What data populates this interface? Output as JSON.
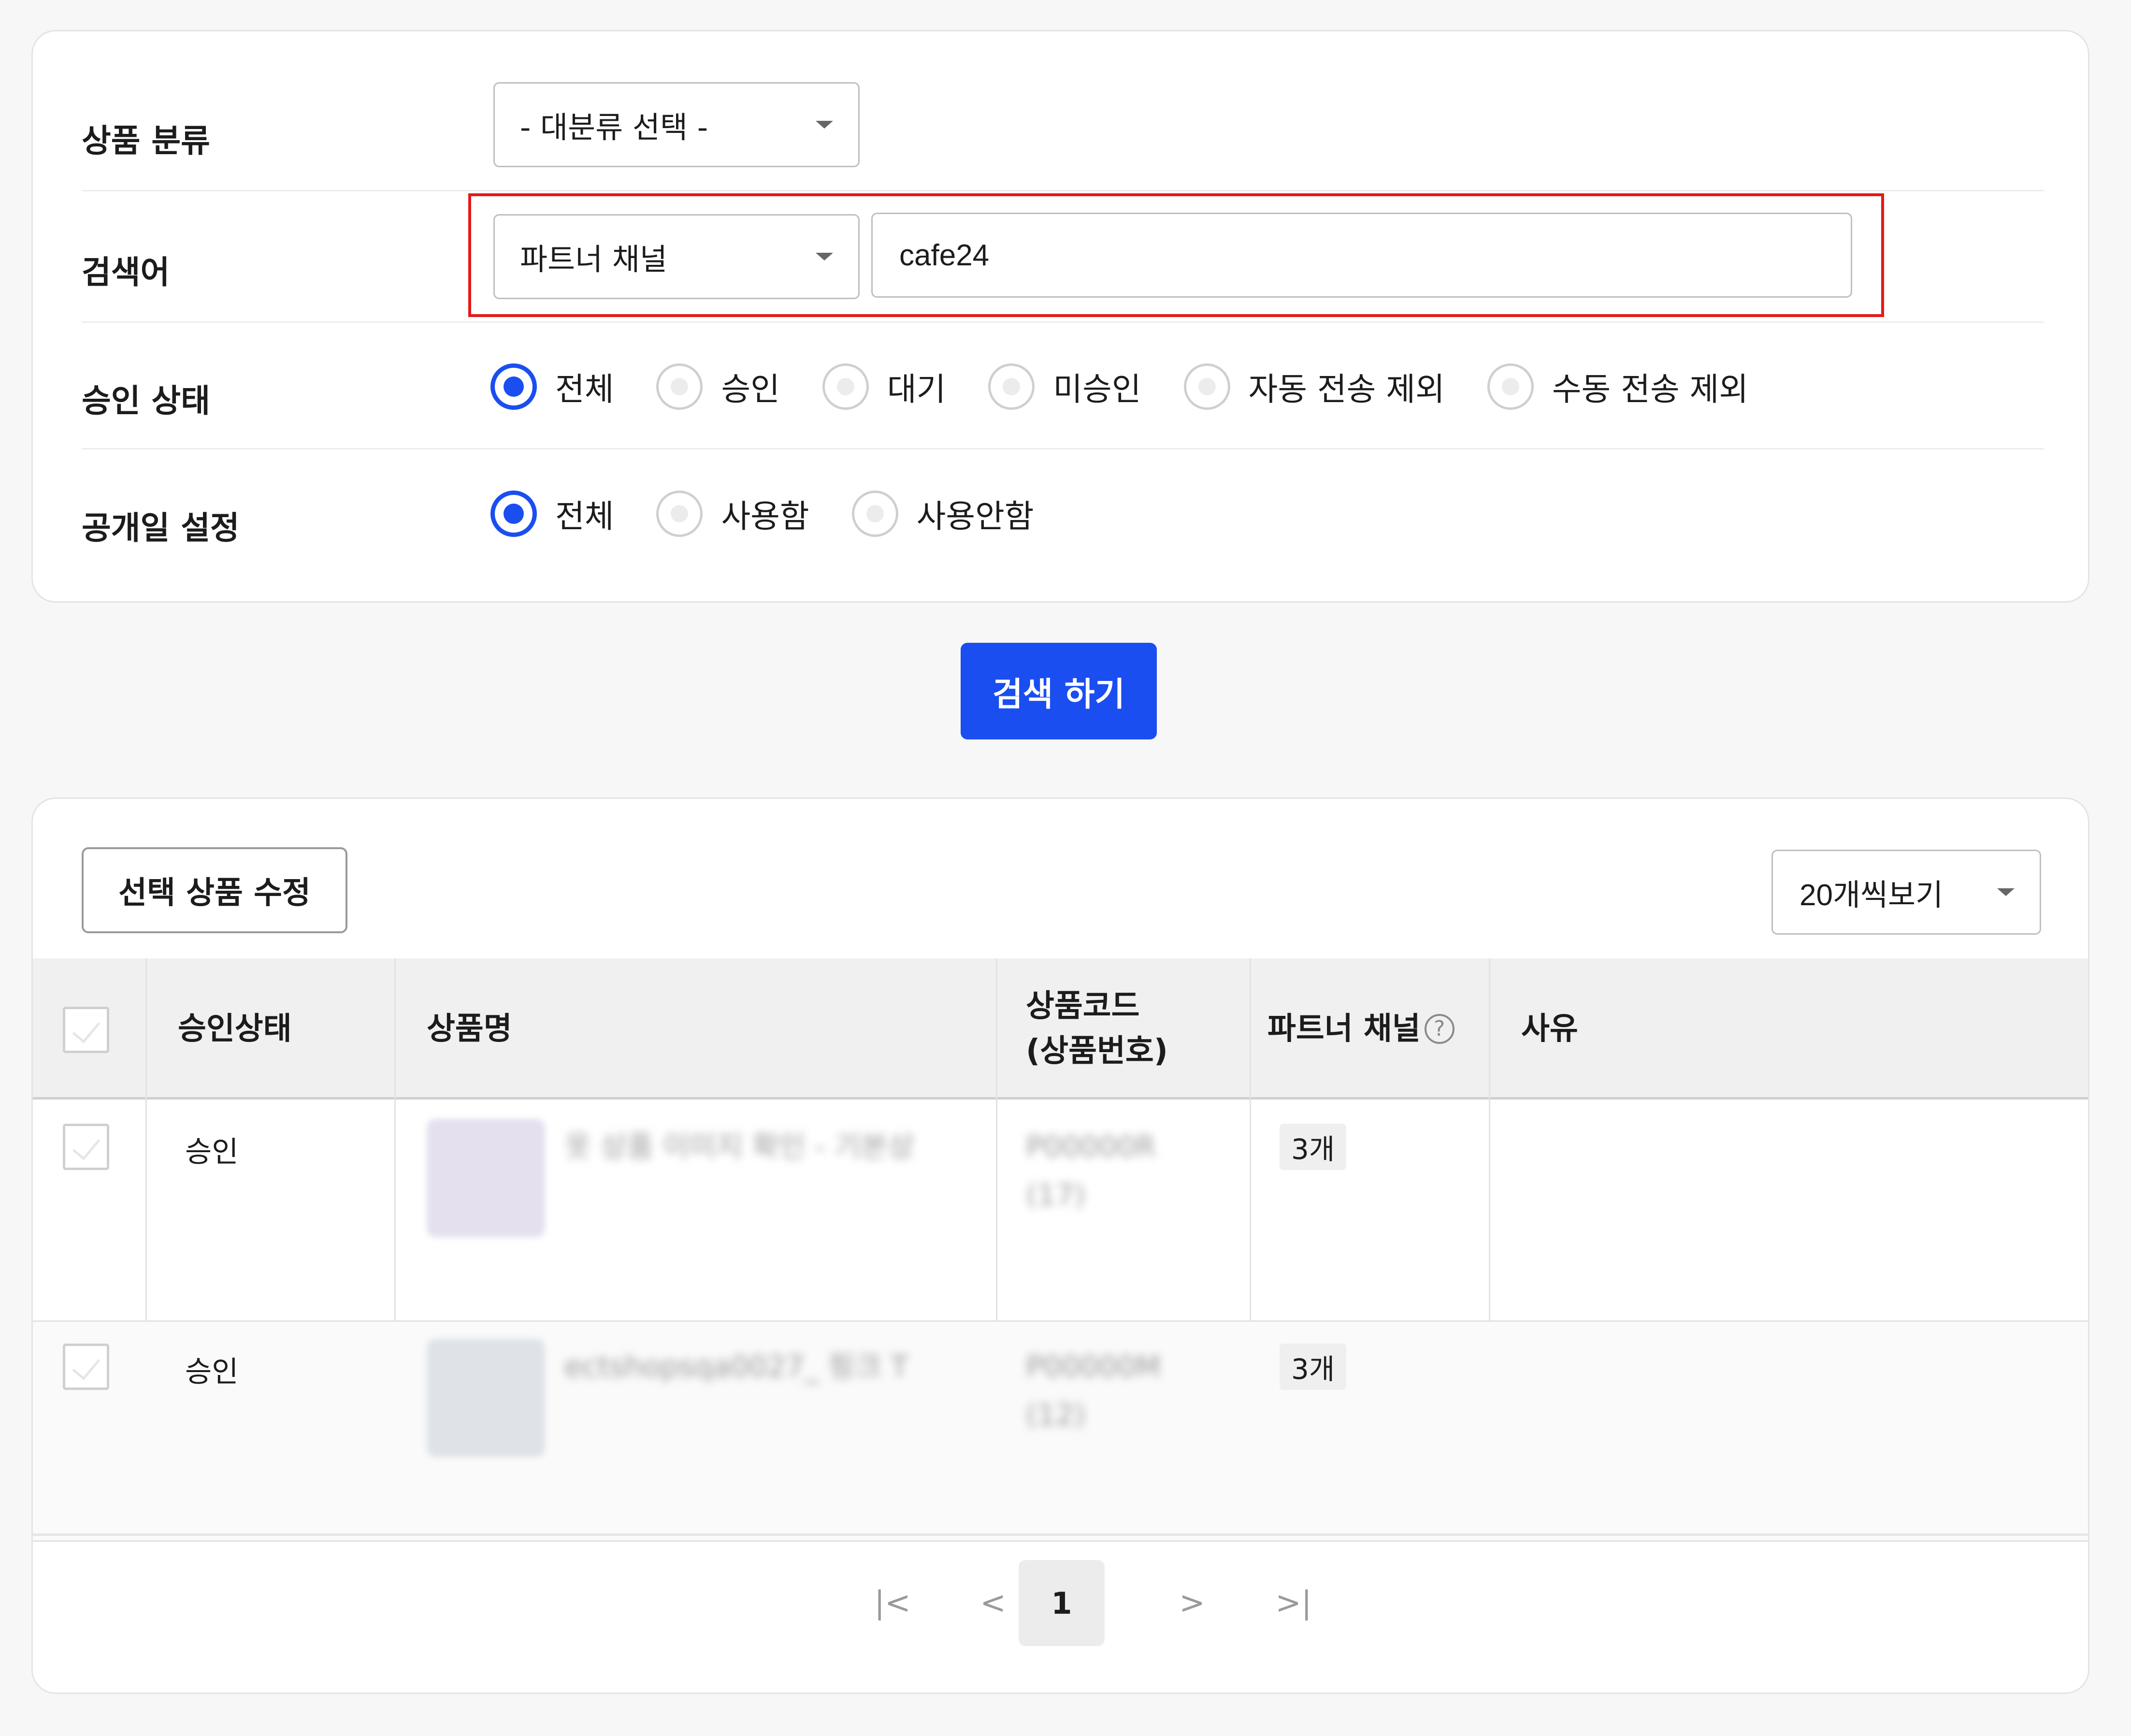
{
  "filters": {
    "category": {
      "label": "상품 분류",
      "selected": "- 대분류 선택 -"
    },
    "keyword": {
      "label": "검색어",
      "field_selected": "파트너 채널",
      "value": "cafe24"
    },
    "approval_status": {
      "label": "승인 상태",
      "options": [
        "전체",
        "승인",
        "대기",
        "미승인",
        "자동 전송 제외",
        "수동 전송 제외"
      ],
      "selected": "전체"
    },
    "publish_date": {
      "label": "공개일 설정",
      "options": [
        "전체",
        "사용함",
        "사용안함"
      ],
      "selected": "전체"
    }
  },
  "search_button_label": "검색 하기",
  "list": {
    "edit_selected_label": "선택 상품 수정",
    "page_size_selected": "20개씩보기",
    "columns": {
      "status": "승인상태",
      "name": "상품명",
      "code_line1": "상품코드",
      "code_line2": "(상품번호)",
      "partner": "파트너 채널",
      "reason": "사유"
    },
    "rows": [
      {
        "status": "승인",
        "name": "옷 상품 이미지 확인 - 기본상",
        "code": "P00000R",
        "number": "(17)",
        "partner_count": "3개",
        "reason": ""
      },
      {
        "status": "승인",
        "name": "ectshopsqa0027_ 핑크 T",
        "code": "P00000M",
        "number": "(12)",
        "partner_count": "3개",
        "reason": ""
      }
    ]
  },
  "pagination": {
    "first": "|<",
    "prev": "<",
    "current": "1",
    "next": ">",
    "last": ">|"
  },
  "colors": {
    "accent": "#1a4ef0",
    "highlight": "#e41a1a"
  }
}
